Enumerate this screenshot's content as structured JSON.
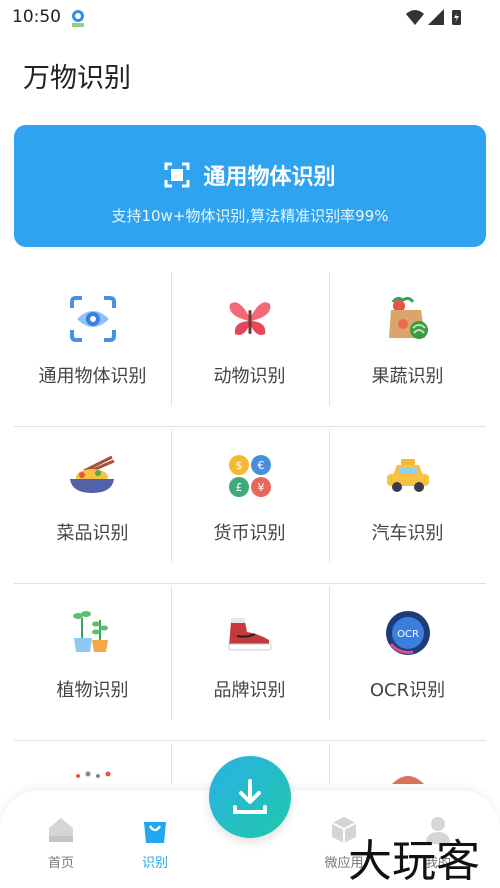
{
  "status_bar": {
    "time": "10:50"
  },
  "page": {
    "title": "万物识别"
  },
  "hero": {
    "title": "通用物体识别",
    "subtitle": "支持10w+物体识别,算法精准识别率99%",
    "background": "#2fa3f0"
  },
  "grid": [
    [
      {
        "label": "通用物体识别",
        "icon": "eye-scan-icon"
      },
      {
        "label": "动物识别",
        "icon": "butterfly-icon"
      },
      {
        "label": "果蔬识别",
        "icon": "vegetables-bag-icon"
      }
    ],
    [
      {
        "label": "菜品识别",
        "icon": "noodle-bowl-icon"
      },
      {
        "label": "货币识别",
        "icon": "coins-icon"
      },
      {
        "label": "汽车识别",
        "icon": "taxi-icon"
      }
    ],
    [
      {
        "label": "植物识别",
        "icon": "plant-icon"
      },
      {
        "label": "品牌识别",
        "icon": "sneaker-icon"
      },
      {
        "label": "OCR识别",
        "icon": "ocr-icon"
      }
    ]
  ],
  "bottom_nav": {
    "items": [
      {
        "label": "首页",
        "icon": "home-icon",
        "active": false
      },
      {
        "label": "识别",
        "icon": "shopping-bag-icon",
        "active": true
      },
      {
        "label": "微应用",
        "icon": "cube-icon",
        "active": false
      },
      {
        "label": "我的",
        "icon": "user-icon",
        "active": false
      }
    ],
    "fab_icon": "download-icon",
    "active_color": "#23a7f0"
  },
  "watermark": {
    "text": "大玩客"
  }
}
